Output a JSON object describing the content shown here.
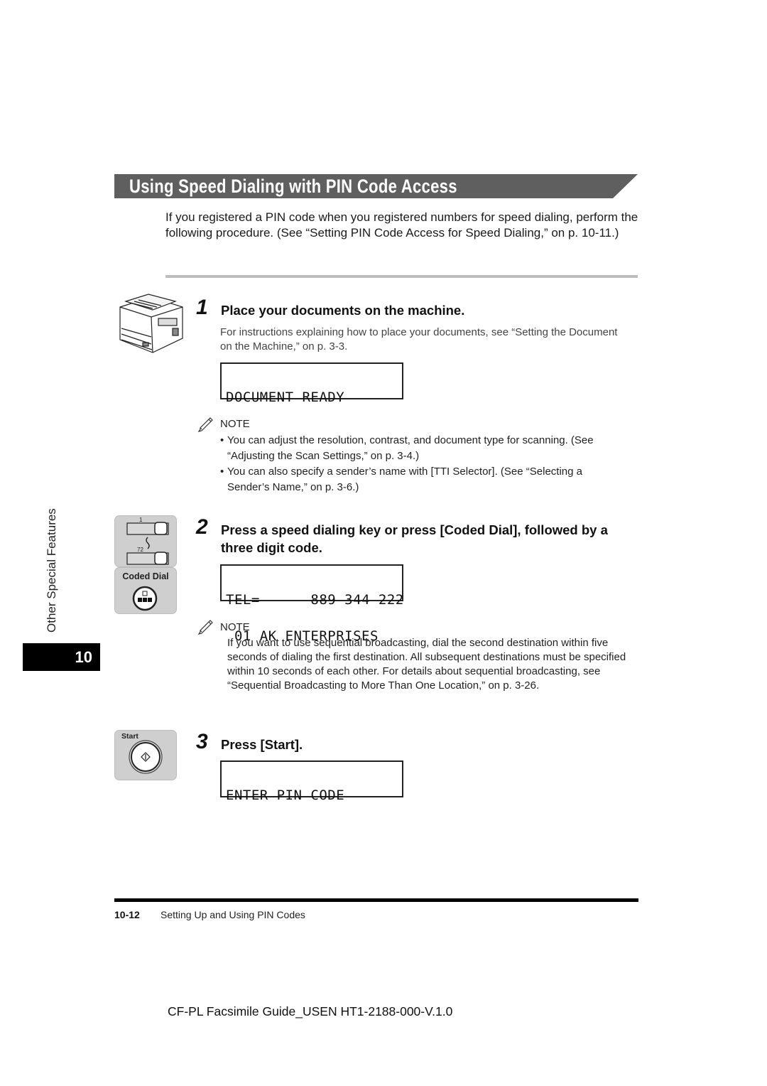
{
  "section": {
    "title": "Using Speed Dialing with PIN Code Access",
    "intro": "If you registered a PIN code when you registered numbers for speed dialing, perform the following procedure. (See “Setting PIN Code Access for Speed Dialing,” on p. 10-11.)"
  },
  "sidebar": {
    "chapter_label": "Other Special Features",
    "chapter_number": "10"
  },
  "steps": [
    {
      "number": "1",
      "title": "Place your documents on the machine.",
      "description": "For instructions explaining how to place your documents, see “Setting the Document on the Machine,” on p. 3-3.",
      "display": [
        "DOCUMENT READY",
        ""
      ],
      "illustration": "fax-machine-icon",
      "note": {
        "label": "NOTE",
        "items": [
          "You can adjust the resolution, contrast, and document type for scanning. (See “Adjusting the Scan Settings,” on p. 3-4.)",
          "You can also specify a sender’s name with [TTI Selector]. (See “Selecting a Sender’s Name,” on p. 3-6.)"
        ]
      }
    },
    {
      "number": "2",
      "title": "Press a speed dialing key or press [Coded Dial], followed by a three digit code.",
      "display": [
        "TEL=      889 344 222",
        " 01 AK ENTERPRISES"
      ],
      "illustration": {
        "speed_keys": {
          "first": "1",
          "last": "72"
        },
        "coded_dial_label": "Coded Dial"
      },
      "note": {
        "label": "NOTE",
        "text": "If you want to use sequential broadcasting, dial the second destination within five seconds of dialing the first destination. All subsequent destinations must be specified within 10 seconds of each other. For details about sequential broadcasting, see “Sequential Broadcasting to More Than One Location,” on p. 3-26."
      }
    },
    {
      "number": "3",
      "title": "Press [Start].",
      "display": [
        "ENTER PIN CODE",
        ""
      ],
      "illustration": {
        "start_label": "Start"
      }
    }
  ],
  "footer": {
    "page_number": "10-12",
    "section_name": "Setting Up and Using PIN Codes",
    "document_id": "CF-PL Facsimile Guide_USEN HT1-2188-000-V.1.0"
  },
  "colors": {
    "banner": "#5f5f5f",
    "panel": "#cfcfcf",
    "rule": "#bdbdbd"
  }
}
